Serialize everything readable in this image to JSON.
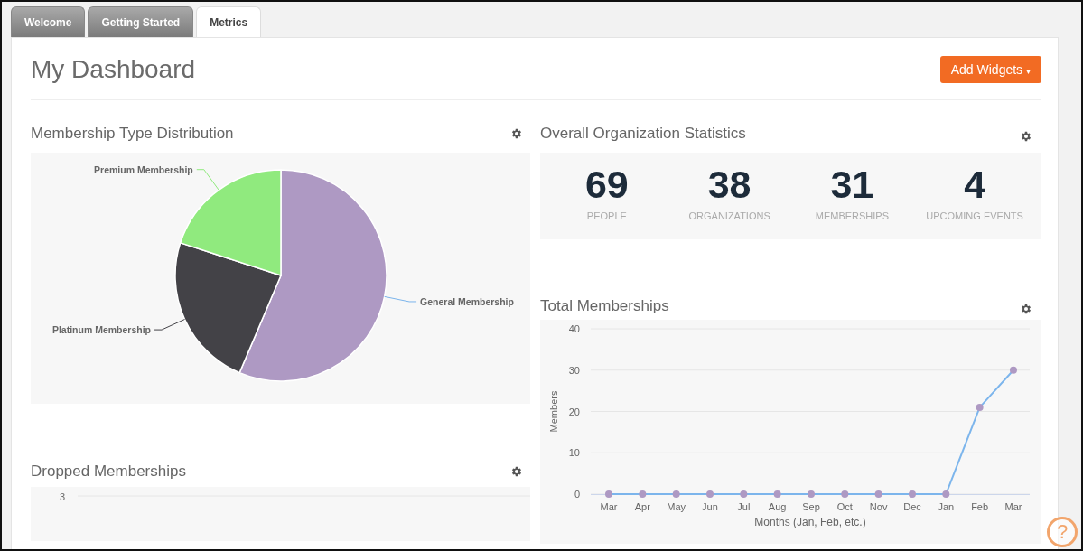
{
  "tabs": [
    {
      "label": "Welcome",
      "selected": false
    },
    {
      "label": "Getting Started",
      "selected": false
    },
    {
      "label": "Metrics",
      "selected": true
    }
  ],
  "title": "My Dashboard",
  "add_button": {
    "label": "Add Widgets",
    "caret": "▾"
  },
  "membership_type": {
    "title": "Membership Type Distribution",
    "chart_data": {
      "type": "pie",
      "categories": [
        "General Membership",
        "Platinum Membership",
        "Premium Membership"
      ],
      "values": [
        0.564,
        0.236,
        0.2
      ],
      "colors": [
        "#ae99c3",
        "#434247",
        "#90ea7e"
      ]
    }
  },
  "stats": {
    "title": "Overall Organization Statistics",
    "items": [
      {
        "value": "69",
        "label": "PEOPLE"
      },
      {
        "value": "38",
        "label": "ORGANIZATIONS"
      },
      {
        "value": "31",
        "label": "MEMBERSHIPS"
      },
      {
        "value": "4",
        "label": "UPCOMING EVENTS"
      }
    ]
  },
  "total": {
    "title": "Total Memberships",
    "chart_data": {
      "type": "line",
      "xlabel": "Months (Jan, Feb, etc.)",
      "ylabel": "Members",
      "categories": [
        "Mar",
        "Apr",
        "May",
        "Jun",
        "Jul",
        "Aug",
        "Sep",
        "Oct",
        "Nov",
        "Dec",
        "Jan",
        "Feb",
        "Mar"
      ],
      "series": [
        {
          "color": "#7cb5ec",
          "marker": true,
          "values": [
            0,
            0,
            0,
            0,
            0,
            0,
            0,
            0,
            0,
            0,
            0,
            21,
            30
          ]
        }
      ],
      "ylim": [
        0,
        40
      ],
      "yticks": [
        0,
        10,
        20,
        30,
        40
      ],
      "grid": true
    }
  },
  "dropped": {
    "title": "Dropped Memberships",
    "ytick": "3"
  },
  "help": {
    "label": "?"
  }
}
